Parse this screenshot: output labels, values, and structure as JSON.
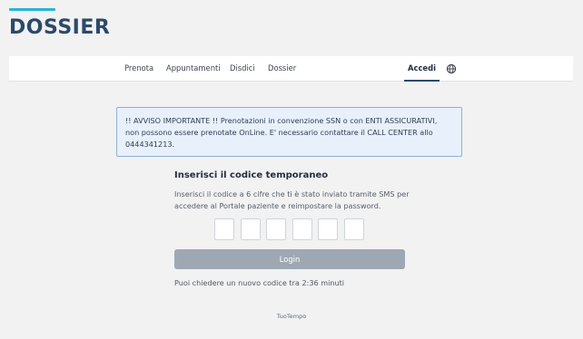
{
  "brand": {
    "logo_text": "DOSSIER",
    "accent_color": "#29b6d3",
    "logo_color": "#2b4a6b"
  },
  "nav": {
    "items": [
      {
        "label": "Prenota"
      },
      {
        "label": "Appuntamenti"
      },
      {
        "label": "Disdici"
      },
      {
        "label": "Dossier"
      }
    ],
    "login_label": "Accedi",
    "language_icon": "globe-icon"
  },
  "notice": {
    "text": "!! AVVISO IMPORTANTE !! Prenotazioni in convenzione SSN o con ENTI ASSICURATIVI, non possono essere prenotate OnLine. E' necessario contattare il CALL CENTER allo 0444341213."
  },
  "otp": {
    "title": "Inserisci il codice temporaneo",
    "description": "Inserisci il codice a 6 cifre che ti è stato inviato tramite SMS per accedere al Portale paziente e reimpostare la password.",
    "digits": [
      "",
      "",
      "",
      "",
      "",
      ""
    ],
    "login_button": "Login",
    "resend_text": "Puoi chiedere un nuovo codice tra 2:36 minuti"
  },
  "footer": {
    "text": "TuoTempo"
  }
}
